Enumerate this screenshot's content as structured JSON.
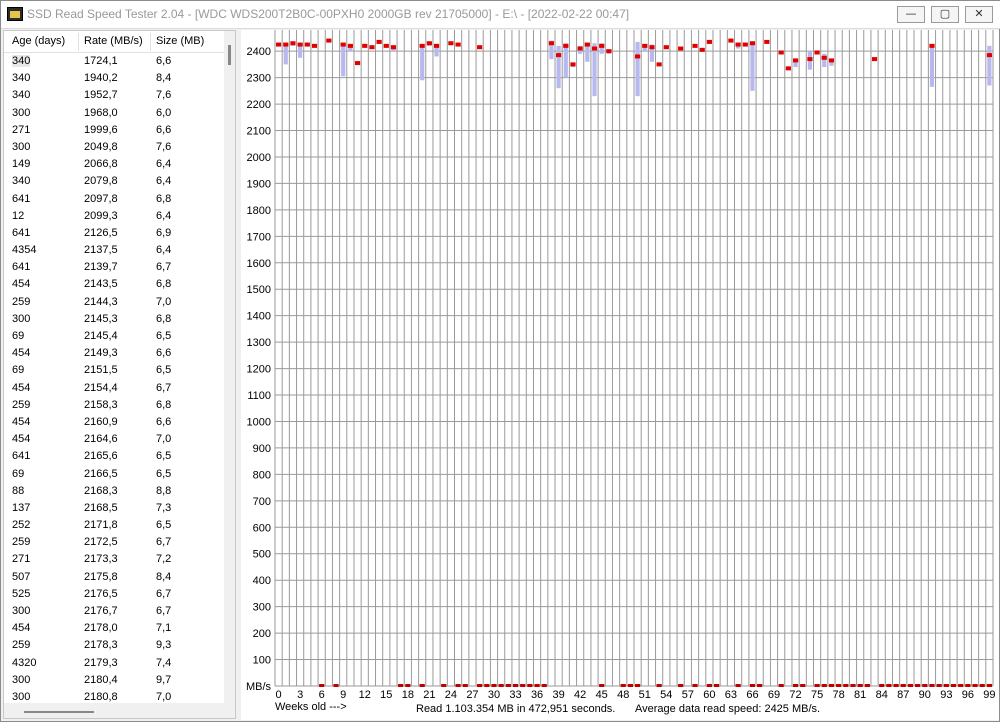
{
  "window": {
    "title": "SSD Read Speed Tester 2.04 - [WDC WDS200T2B0C-00PXH0 2000GB rev 21705000] - E:\\ - [2022-02-22 00:47]",
    "minimize": "—",
    "maximize": "▢",
    "close": "✕",
    "app_icon": "app-icon"
  },
  "table": {
    "headers": [
      "Age (days)",
      "Rate (MB/s)",
      "Size (MB)"
    ],
    "rows": [
      [
        "340",
        "1724,1",
        "6,6"
      ],
      [
        "340",
        "1940,2",
        "8,4"
      ],
      [
        "340",
        "1952,7",
        "7,6"
      ],
      [
        "300",
        "1968,0",
        "6,0"
      ],
      [
        "271",
        "1999,6",
        "6,6"
      ],
      [
        "300",
        "2049,8",
        "7,6"
      ],
      [
        "149",
        "2066,8",
        "6,4"
      ],
      [
        "340",
        "2079,8",
        "6,4"
      ],
      [
        "641",
        "2097,8",
        "6,8"
      ],
      [
        "12",
        "2099,3",
        "6,4"
      ],
      [
        "641",
        "2126,5",
        "6,9"
      ],
      [
        "4354",
        "2137,5",
        "6,4"
      ],
      [
        "641",
        "2139,7",
        "6,7"
      ],
      [
        "454",
        "2143,5",
        "6,8"
      ],
      [
        "259",
        "2144,3",
        "7,0"
      ],
      [
        "300",
        "2145,3",
        "6,8"
      ],
      [
        "69",
        "2145,4",
        "6,5"
      ],
      [
        "454",
        "2149,3",
        "6,6"
      ],
      [
        "69",
        "2151,5",
        "6,5"
      ],
      [
        "454",
        "2154,4",
        "6,7"
      ],
      [
        "259",
        "2158,3",
        "6,8"
      ],
      [
        "454",
        "2160,9",
        "6,6"
      ],
      [
        "454",
        "2164,6",
        "7,0"
      ],
      [
        "641",
        "2165,6",
        "6,5"
      ],
      [
        "69",
        "2166,5",
        "6,5"
      ],
      [
        "88",
        "2168,3",
        "8,8"
      ],
      [
        "137",
        "2168,5",
        "7,3"
      ],
      [
        "252",
        "2171,8",
        "6,5"
      ],
      [
        "259",
        "2172,5",
        "6,7"
      ],
      [
        "271",
        "2173,3",
        "7,2"
      ],
      [
        "507",
        "2175,8",
        "8,4"
      ],
      [
        "525",
        "2176,5",
        "6,7"
      ],
      [
        "300",
        "2176,7",
        "6,7"
      ],
      [
        "454",
        "2178,0",
        "7,1"
      ],
      [
        "259",
        "2178,3",
        "9,3"
      ],
      [
        "4320",
        "2179,3",
        "7,4"
      ],
      [
        "300",
        "2180,4",
        "9,7"
      ],
      [
        "300",
        "2180,8",
        "7,0"
      ]
    ]
  },
  "status": {
    "weeks_label": "Weeks old --->",
    "read_summary": "Read 1.103.354 MB in 472,951 seconds.",
    "average": "Average data read speed: 2425 MB/s."
  },
  "colors": {
    "marker": "#e00000",
    "range": "#b8b8f0",
    "grid": "#9a9a9a",
    "zero_marker": "#c00000"
  },
  "chart_data": {
    "type": "scatter",
    "ylabel": "MB/s",
    "xlabel": "Weeks old --->",
    "ylim": [
      0,
      2480
    ],
    "yticks": [
      100,
      200,
      300,
      400,
      500,
      600,
      700,
      800,
      900,
      1000,
      1100,
      1200,
      1300,
      1400,
      1500,
      1600,
      1700,
      1800,
      1900,
      2000,
      2100,
      2200,
      2300,
      2400
    ],
    "xlim": [
      0,
      99
    ],
    "xticks": [
      0,
      3,
      6,
      9,
      12,
      15,
      18,
      21,
      24,
      27,
      30,
      33,
      36,
      39,
      42,
      45,
      48,
      51,
      54,
      57,
      60,
      63,
      66,
      69,
      72,
      75,
      78,
      81,
      84,
      87,
      90,
      93,
      96,
      99
    ],
    "grid": true,
    "points": [
      {
        "week": 0,
        "avg": 2425,
        "min": 2420,
        "max": 2430
      },
      {
        "week": 1,
        "avg": 2425,
        "min": 2350,
        "max": 2430
      },
      {
        "week": 2,
        "avg": 2430,
        "min": 2420,
        "max": 2435
      },
      {
        "week": 3,
        "avg": 2425,
        "min": 2375,
        "max": 2430
      },
      {
        "week": 4,
        "avg": 2425,
        "min": 2420,
        "max": 2430
      },
      {
        "week": 5,
        "avg": 2420,
        "min": 2415,
        "max": 2425
      },
      {
        "week": 7,
        "avg": 2440,
        "min": 2435,
        "max": 2445
      },
      {
        "week": 9,
        "avg": 2425,
        "min": 2305,
        "max": 2430
      },
      {
        "week": 10,
        "avg": 2420,
        "min": 2400,
        "max": 2425
      },
      {
        "week": 11,
        "avg": 2355,
        "min": 2350,
        "max": 2360
      },
      {
        "week": 12,
        "avg": 2420,
        "min": 2415,
        "max": 2425
      },
      {
        "week": 13,
        "avg": 2415,
        "min": 2410,
        "max": 2420
      },
      {
        "week": 14,
        "avg": 2435,
        "min": 2430,
        "max": 2440
      },
      {
        "week": 15,
        "avg": 2420,
        "min": 2415,
        "max": 2425
      },
      {
        "week": 16,
        "avg": 2415,
        "min": 2400,
        "max": 2420
      },
      {
        "week": 20,
        "avg": 2420,
        "min": 2290,
        "max": 2425
      },
      {
        "week": 21,
        "avg": 2430,
        "min": 2420,
        "max": 2435
      },
      {
        "week": 22,
        "avg": 2420,
        "min": 2380,
        "max": 2425
      },
      {
        "week": 24,
        "avg": 2430,
        "min": 2425,
        "max": 2435
      },
      {
        "week": 25,
        "avg": 2425,
        "min": 2420,
        "max": 2430
      },
      {
        "week": 28,
        "avg": 2415,
        "min": 2410,
        "max": 2420
      },
      {
        "week": 38,
        "avg": 2430,
        "min": 2370,
        "max": 2440
      },
      {
        "week": 39,
        "avg": 2385,
        "min": 2260,
        "max": 2420
      },
      {
        "week": 40,
        "avg": 2420,
        "min": 2300,
        "max": 2430
      },
      {
        "week": 41,
        "avg": 2350,
        "min": 2340,
        "max": 2355
      },
      {
        "week": 42,
        "avg": 2410,
        "min": 2390,
        "max": 2420
      },
      {
        "week": 43,
        "avg": 2425,
        "min": 2360,
        "max": 2430
      },
      {
        "week": 44,
        "avg": 2410,
        "min": 2230,
        "max": 2430
      },
      {
        "week": 45,
        "avg": 2420,
        "min": 2390,
        "max": 2430
      },
      {
        "week": 46,
        "avg": 2400,
        "min": 2390,
        "max": 2405
      },
      {
        "week": 50,
        "avg": 2380,
        "min": 2230,
        "max": 2435
      },
      {
        "week": 51,
        "avg": 2420,
        "min": 2400,
        "max": 2425
      },
      {
        "week": 52,
        "avg": 2415,
        "min": 2360,
        "max": 2425
      },
      {
        "week": 53,
        "avg": 2350,
        "min": 2345,
        "max": 2355
      },
      {
        "week": 54,
        "avg": 2415,
        "min": 2410,
        "max": 2420
      },
      {
        "week": 56,
        "avg": 2410,
        "min": 2405,
        "max": 2415
      },
      {
        "week": 58,
        "avg": 2420,
        "min": 2415,
        "max": 2425
      },
      {
        "week": 59,
        "avg": 2405,
        "min": 2400,
        "max": 2410
      },
      {
        "week": 60,
        "avg": 2435,
        "min": 2430,
        "max": 2440
      },
      {
        "week": 63,
        "avg": 2440,
        "min": 2435,
        "max": 2445
      },
      {
        "week": 64,
        "avg": 2425,
        "min": 2410,
        "max": 2430
      },
      {
        "week": 65,
        "avg": 2425,
        "min": 2420,
        "max": 2430
      },
      {
        "week": 66,
        "avg": 2430,
        "min": 2250,
        "max": 2435
      },
      {
        "week": 68,
        "avg": 2435,
        "min": 2430,
        "max": 2440
      },
      {
        "week": 70,
        "avg": 2395,
        "min": 2390,
        "max": 2400
      },
      {
        "week": 71,
        "avg": 2335,
        "min": 2330,
        "max": 2340
      },
      {
        "week": 72,
        "avg": 2365,
        "min": 2340,
        "max": 2370
      },
      {
        "week": 74,
        "avg": 2370,
        "min": 2330,
        "max": 2400
      },
      {
        "week": 75,
        "avg": 2395,
        "min": 2390,
        "max": 2400
      },
      {
        "week": 76,
        "avg": 2375,
        "min": 2340,
        "max": 2390
      },
      {
        "week": 77,
        "avg": 2365,
        "min": 2345,
        "max": 2370
      },
      {
        "week": 83,
        "avg": 2370,
        "min": 2365,
        "max": 2375
      },
      {
        "week": 91,
        "avg": 2420,
        "min": 2265,
        "max": 2425
      },
      {
        "week": 99,
        "avg": 2385,
        "min": 2270,
        "max": 2420
      }
    ],
    "zero_weeks": [
      6,
      8,
      17,
      18,
      20,
      23,
      25,
      26,
      28,
      29,
      30,
      31,
      32,
      33,
      34,
      35,
      36,
      37,
      45,
      48,
      49,
      50,
      53,
      56,
      58,
      60,
      61,
      64,
      66,
      67,
      70,
      72,
      73,
      75,
      76,
      77,
      78,
      79,
      80,
      81,
      82,
      84,
      85,
      86,
      87,
      88,
      89,
      90,
      91,
      92,
      93,
      94,
      95,
      96,
      97,
      98,
      99
    ]
  }
}
